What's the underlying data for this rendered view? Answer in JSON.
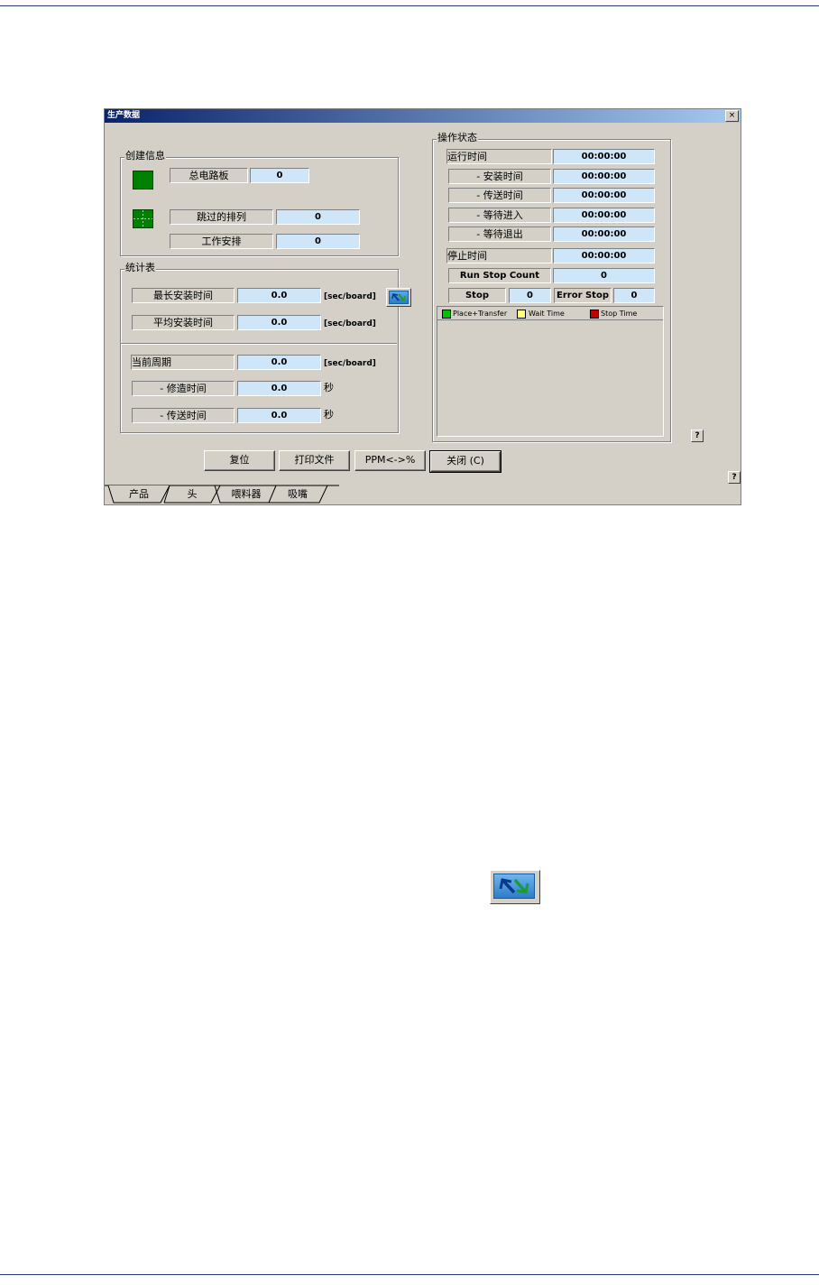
{
  "window": {
    "title": "生产数据",
    "close_label": "×"
  },
  "create_info": {
    "title": "创建信息",
    "total_boards_label": "总电路板",
    "total_boards_value": "0",
    "skipped_array_label": "跳过的排列",
    "skipped_array_value": "0",
    "work_schedule_label": "工作安排",
    "work_schedule_value": "0",
    "colors": {
      "board_icon": "#008000"
    }
  },
  "stats": {
    "title": "统计表",
    "max_place_label": "最长安装时间",
    "max_place_value": "0.0",
    "max_place_unit": "[sec/board]",
    "avg_place_label": "平均安装时间",
    "avg_place_value": "0.0",
    "avg_place_unit": "[sec/board]",
    "cycle_label": "当前周期",
    "cycle_value": "0.0",
    "cycle_unit": "[sec/board]",
    "build_label": "- 修造时间",
    "build_value": "0.0",
    "build_unit": "秒",
    "transfer_label": "- 传送时间",
    "transfer_value": "0.0",
    "transfer_unit": "秒",
    "refresh_icon": "refresh-icon"
  },
  "op_status": {
    "title": "操作状态",
    "run_time_label": "运行时间",
    "run_time_value": "00:00:00",
    "place_time_label": "- 安装时间",
    "place_time_value": "00:00:00",
    "transfer_time_label": "- 传送时间",
    "transfer_time_value": "00:00:00",
    "wait_in_label": "- 等待进入",
    "wait_in_value": "00:00:00",
    "wait_out_label": "- 等待退出",
    "wait_out_value": "00:00:00",
    "stop_time_label": "停止时间",
    "stop_time_value": "00:00:00",
    "run_stop_count_label": "Run Stop Count",
    "run_stop_count_value": "0",
    "stop_label": "Stop",
    "stop_value": "0",
    "error_stop_label": "Error Stop",
    "error_stop_value": "0",
    "legend": [
      {
        "label": "Place+Transfer",
        "color": "#00c000"
      },
      {
        "label": "Wait Time",
        "color": "#ffff80"
      },
      {
        "label": "Stop Time",
        "color": "#c00000"
      }
    ]
  },
  "buttons": {
    "reset": "复位",
    "print": "打印文件",
    "ppm": "PPM<->%",
    "close": "关闭 (C)"
  },
  "help_label": "?",
  "tabs": [
    "产品",
    "头",
    "喂料器",
    "吸嘴"
  ]
}
